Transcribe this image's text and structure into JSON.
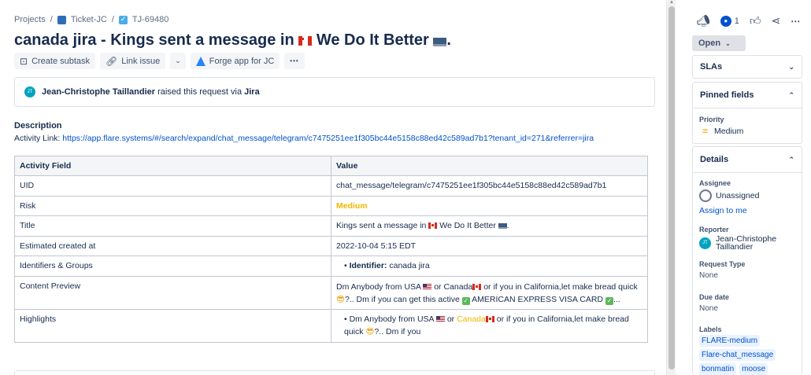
{
  "breadcrumb": {
    "projects": "Projects",
    "sep": "/",
    "project": "Ticket-JC",
    "issue_key": "TJ-69480"
  },
  "issue": {
    "title_prefix": "canada jira - Kings sent a message in",
    "title_suffix": "We Do It Better",
    "title_end": "."
  },
  "toolbar": {
    "create_subtask": "Create subtask",
    "link_issue": "Link issue",
    "forge_app": "Forge app for JC",
    "more": "•••"
  },
  "request": {
    "avatar_initials": "JT",
    "requester": "Jean-Christophe Taillandier",
    "via_text": "raised this request via",
    "channel": "Jira"
  },
  "description": {
    "label": "Description",
    "link_prefix": "Activity Link:",
    "link": "https://app.flare.systems/#/search/expand/chat_message/telegram/c7475251ee1f305bc44e5158c88ed42c589ad7b1?tenant_id=271&referrer=jira"
  },
  "table": {
    "headers": [
      "Activity Field",
      "Value"
    ],
    "uid_label": "UID",
    "uid_value": "chat_message/telegram/c7475251ee1f305bc44e5158c88ed42c589ad7b1",
    "risk_label": "Risk",
    "risk_value": "Medium",
    "title_label": "Title",
    "title_value_a": "Kings sent a message in",
    "title_value_b": "We Do It Better",
    "title_value_c": ".",
    "created_label": "Estimated created at",
    "created_value": "2022-10-04 5:15 EDT",
    "identifiers_label": "Identifiers & Groups",
    "identifier_key": "Identifier:",
    "identifier_value": "canada jira",
    "preview_label": "Content Preview",
    "preview_a": "Dm Anybody from USA",
    "preview_b": "or Canada",
    "preview_c": "or if you in California,let make bread quick",
    "preview_d": "?.. Dm if you can get this active",
    "preview_e": "AMERICAN EXPRESS VISA CARD",
    "preview_f": "...",
    "highlights_label": "Highlights",
    "hl_a": "Dm Anybody from USA",
    "hl_b": "or",
    "hl_canada": "Canada",
    "hl_c": "or if you in California,let make bread quick",
    "hl_d": "?.. Dm if you"
  },
  "sidebar": {
    "watch_count": "1",
    "status": "Open",
    "slas": "SLAs",
    "pinned_fields": "Pinned fields",
    "priority_label": "Priority",
    "priority_value": "Medium",
    "details": "Details",
    "assignee_label": "Assignee",
    "assignee_value": "Unassigned",
    "assign_to_me": "Assign to me",
    "reporter_label": "Reporter",
    "reporter_line1": "Jean-Christophe",
    "reporter_line2": "Taillandier",
    "request_type_label": "Request Type",
    "request_type_value": "None",
    "due_date_label": "Due date",
    "due_date_value": "None",
    "labels_label": "Labels",
    "labels": [
      "FLARE-medium",
      "Flare-chat_message",
      "bonmatin",
      "moose"
    ]
  },
  "colors": {
    "link": "#0052cc",
    "risk_medium": "#f2b600",
    "status_bg": "#dfe1e6"
  }
}
